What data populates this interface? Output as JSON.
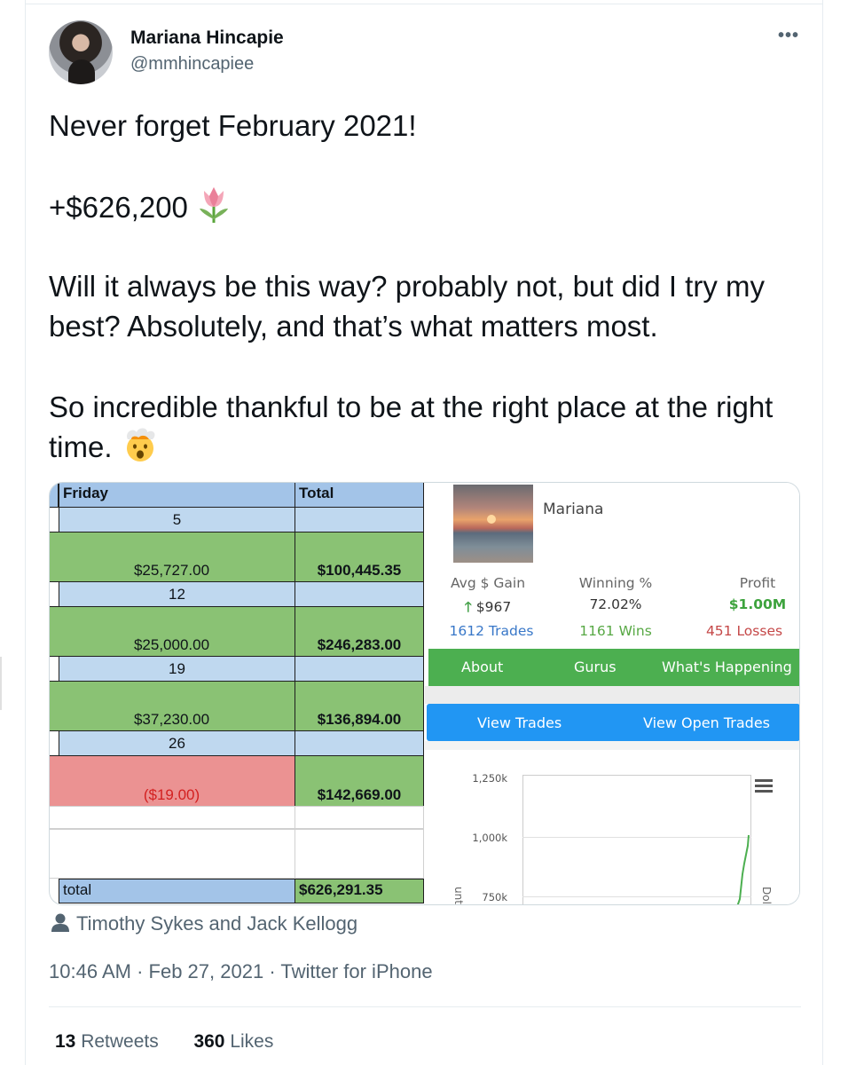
{
  "author": {
    "name": "Mariana Hincapie",
    "handle": "@mmhincapiee"
  },
  "menu_icon": "more-horizontal-icon",
  "tweet": {
    "line1": "Never forget February 2021!",
    "line2": "+$626,200",
    "line2_emoji": "tulip",
    "line3": "Will it always be this way? probably not, but did I try my best? Absolutely, and that’s what matters most.",
    "line4": "So incredible thankful to be at the right place at the right time.",
    "line4_emoji": "exploding-head"
  },
  "spreadsheet": {
    "headers": {
      "friday": "Friday",
      "total": "Total"
    },
    "rows": [
      {
        "date": "5",
        "friday": "$25,727.00",
        "total": "$100,445.35",
        "status": "gain"
      },
      {
        "date": "12",
        "friday": "$25,000.00",
        "total": "$246,283.00",
        "status": "gain"
      },
      {
        "date": "19",
        "friday": "$37,230.00",
        "total": "$136,894.00",
        "status": "gain"
      },
      {
        "date": "26",
        "friday": "($19.00)",
        "total": "$142,669.00",
        "status": "loss"
      }
    ],
    "footer": {
      "label": "total",
      "value": "$626,291.35"
    },
    "colors": {
      "header": "#a3c4e8",
      "date": "#bfd8ef",
      "gain": "#8ac274",
      "loss": "#eb9292"
    }
  },
  "profile": {
    "name": "Mariana",
    "stats": {
      "avg_gain_label": "Avg $ Gain",
      "avg_gain_value": "$967",
      "winning_label": "Winning %",
      "winning_value": "72.02%",
      "profit_label": "Profit",
      "profit_value": "$1.00M"
    },
    "counts": {
      "trades": "1612 Trades",
      "wins": "1161 Wins",
      "losses": "451 Losses"
    },
    "nav": {
      "about": "About",
      "gurus": "Gurus",
      "happening": "What's Happening"
    },
    "buttons": {
      "view_trades": "View Trades",
      "view_open": "View Open Trades"
    },
    "chart": {
      "ticks": [
        "1,250k",
        "1,000k",
        "750k"
      ],
      "left_axis_fragment": "unt",
      "right_axis_fragment": "Dol",
      "line_color": "#4caf50",
      "menu_icon": "hamburger-menu-icon"
    }
  },
  "attribution": {
    "icon": "person-icon",
    "text": "Timothy Sykes and Jack Kellogg"
  },
  "meta": {
    "time": "10:46 AM",
    "date": "Feb 27, 2021",
    "source": "Twitter for iPhone"
  },
  "engagement": {
    "retweets_count": "13",
    "retweets_label": "Retweets",
    "likes_count": "360",
    "likes_label": "Likes"
  }
}
